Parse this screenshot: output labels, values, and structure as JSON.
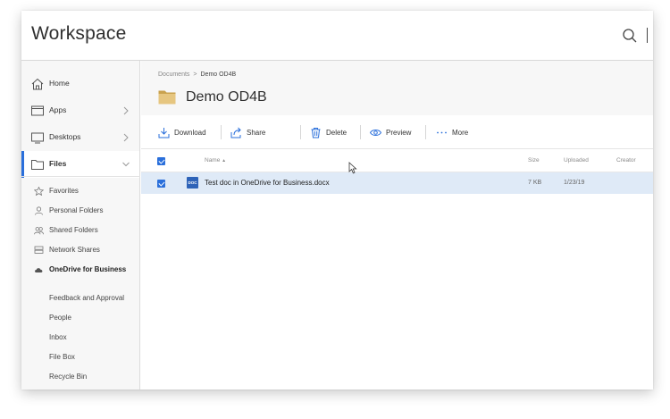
{
  "app": {
    "title": "Workspace"
  },
  "sidebar": {
    "nav": [
      {
        "label": "Home",
        "icon": "home-icon"
      },
      {
        "label": "Apps",
        "icon": "apps-icon"
      },
      {
        "label": "Desktops",
        "icon": "desktop-icon"
      },
      {
        "label": "Files",
        "icon": "folder-icon",
        "active": true
      }
    ],
    "files_items": [
      {
        "label": "Favorites",
        "icon": "star-icon"
      },
      {
        "label": "Personal Folders",
        "icon": "person-icon"
      },
      {
        "label": "Shared Folders",
        "icon": "people-icon"
      },
      {
        "label": "Network Shares",
        "icon": "server-icon"
      },
      {
        "label": "OneDrive for Business",
        "icon": "cloud-icon"
      }
    ],
    "other_items": [
      "Feedback and Approval",
      "People",
      "Inbox",
      "File Box",
      "Recycle Bin"
    ]
  },
  "breadcrumb": {
    "parent": "Documents",
    "current": "Demo OD4B"
  },
  "folder": {
    "title": "Demo OD4B"
  },
  "toolbar": {
    "download": "Download",
    "share": "Share",
    "delete": "Delete",
    "preview": "Preview",
    "more": "More"
  },
  "table": {
    "columns": {
      "name": "Name",
      "size": "Size",
      "uploaded": "Uploaded",
      "creator": "Creator"
    },
    "rows": [
      {
        "icon_text": "DOC",
        "name": "Test doc in OneDrive for Business.docx",
        "size": "7 KB",
        "uploaded": "1/23/19",
        "creator": "",
        "selected": true
      }
    ]
  },
  "colors": {
    "accent": "#2a6fdb",
    "selected_row": "#dfeaf7",
    "folder": "#d9b96d",
    "doc_icon": "#2e63b8"
  }
}
